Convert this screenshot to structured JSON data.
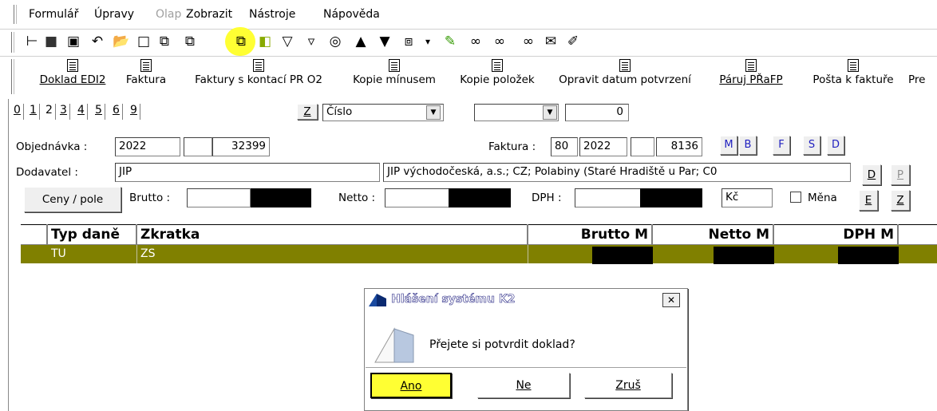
{
  "menu": {
    "items": [
      {
        "label": "Formulář",
        "disabled": false
      },
      {
        "label": "Úpravy",
        "disabled": false
      },
      {
        "label": "Olap",
        "disabled": true
      },
      {
        "label": "Zobrazit",
        "disabled": false
      },
      {
        "label": "Nástroje",
        "disabled": false
      },
      {
        "label": "Nápověda",
        "disabled": false
      }
    ]
  },
  "toolbar": {
    "icons": [
      "tree-icon",
      "save-icon",
      "save-as-icon",
      "undo-icon",
      "open-folder-icon",
      "new-document-icon",
      "copy-icon",
      "paste-icon",
      "book-icon",
      "filter-icon",
      "filter-doc-icon",
      "refresh-icon",
      "arrow-up-icon",
      "arrow-down-icon",
      "export-icon",
      "dropdown-icon",
      "tools-icon",
      "binoculars-icon",
      "find-next-icon",
      "find-all-icon",
      "mail-icon",
      "edit-icon"
    ],
    "highlighted": "paste-icon",
    "highlight_color": "#ffff33"
  },
  "toolbar2": {
    "items": [
      {
        "label": "Doklad EDI2"
      },
      {
        "label": "Faktura"
      },
      {
        "label": "Faktury s kontací PR O2"
      },
      {
        "label": "Kopie mínusem"
      },
      {
        "label": "Kopie položek"
      },
      {
        "label": "Opravit datum potvrzení"
      },
      {
        "label": "Páruj PŘaFP"
      },
      {
        "label": "Pošta k faktuře"
      },
      {
        "label": "Pre"
      }
    ]
  },
  "tabs": [
    "0",
    "1",
    "2",
    "3",
    "4",
    "5",
    "6",
    "9"
  ],
  "sort": {
    "z_label": "Z",
    "field_value": "Číslo",
    "second_value": "",
    "number_value": "0"
  },
  "form": {
    "objednavka_label": "Objednávka :",
    "objednavka_year": "2022",
    "objednavka_mid": "",
    "objednavka_num": "32399",
    "faktura_label": "Faktura :",
    "faktura_type": "80",
    "faktura_year": "2022",
    "faktura_mid": "",
    "faktura_num": "8136",
    "letter_buttons": [
      "M",
      "B",
      "F",
      "S",
      "D"
    ],
    "dodavatel_label": "Dodavatel :",
    "dodavatel_code": "JIP",
    "dodavatel_name": "JIP východočeská, a.s.; CZ; Polabiny (Staré Hradiště u Par; C0",
    "side_buttons": [
      "D",
      "P"
    ],
    "ceny_button": "Ceny / pole",
    "brutto_label": "Brutto :",
    "netto_label": "Netto :",
    "dph_label": "DPH :",
    "currency": "Kč",
    "mena_label": "Měna",
    "bottom_side_buttons": [
      "E",
      "Z"
    ]
  },
  "grid": {
    "columns": [
      "Typ daně",
      "Zkratka",
      "Brutto M",
      "Netto M",
      "DPH M"
    ],
    "rows": [
      {
        "typ_dane": "TU",
        "zkratka": "ZS"
      }
    ],
    "selected_row_color": "#808000"
  },
  "dialog": {
    "title": "Hlášení systému K2",
    "message": "Přejete si potvrdit doklad?",
    "buttons": [
      "Ano",
      "Ne",
      "Zruš"
    ],
    "title_color": "#ffffff",
    "highlight_color": "#ffff33"
  }
}
